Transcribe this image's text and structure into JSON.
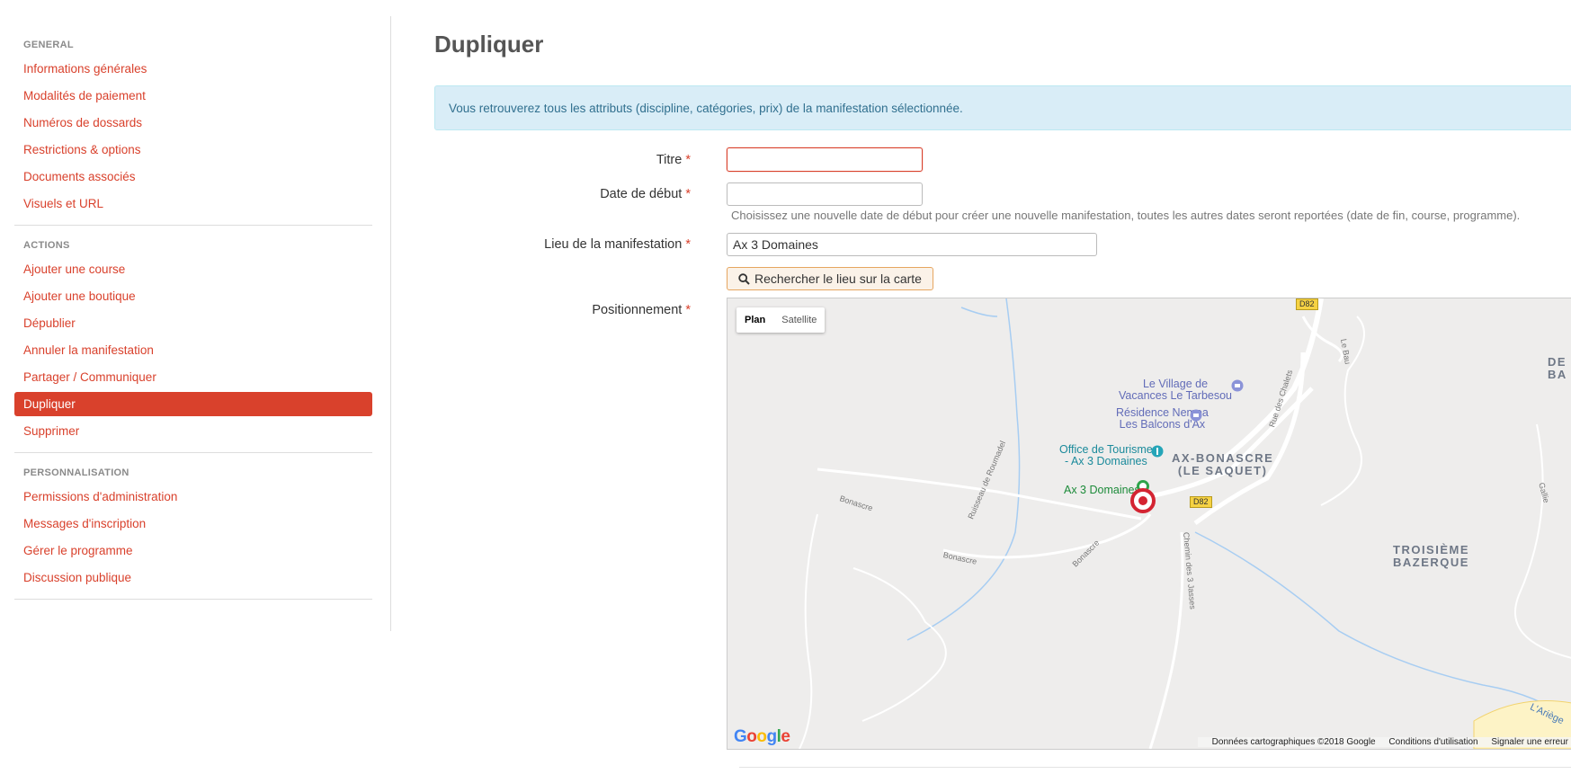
{
  "sidebar": {
    "general_title": "GENERAL",
    "general_items": [
      "Informations générales",
      "Modalités de paiement",
      "Numéros de dossards",
      "Restrictions & options",
      "Documents associés",
      "Visuels et URL"
    ],
    "actions_title": "ACTIONS",
    "actions_items": [
      "Ajouter une course",
      "Ajouter une boutique",
      "Dépublier",
      "Annuler la manifestation",
      "Partager / Communiquer",
      "Dupliquer",
      "Supprimer"
    ],
    "perso_title": "PERSONNALISATION",
    "perso_items": [
      "Permissions d'administration",
      "Messages d'inscription",
      "Gérer le programme",
      "Discussion publique"
    ],
    "active_item": "Dupliquer"
  },
  "page": {
    "title": "Dupliquer",
    "info": "Vous retrouverez tous les attributs (discipline, catégories, prix) de la manifestation sélectionnée."
  },
  "form": {
    "required_mark": "*",
    "titre_label": "Titre",
    "titre_value": "",
    "date_label": "Date de début",
    "date_value": "",
    "date_help": "Choisissez une nouvelle date de début pour créer une nouvelle manifestation, toutes les autres dates seront reportées (date de fin, course, programme).",
    "lieu_label": "Lieu de la manifestation",
    "lieu_value": "Ax 3 Domaines",
    "search_button": "Rechercher le lieu sur la carte",
    "position_label": "Positionnement"
  },
  "map": {
    "plan": "Plan",
    "satellite": "Satellite",
    "poi_village": "Le Village de\nVacances Le Tarbesou",
    "poi_residence": "Résidence Nemea\nLes Balcons d'Ax",
    "poi_office": "Office de Tourisme\n- Ax 3 Domaines",
    "poi_ax": "Ax 3 Domaines",
    "area_bonascre": "AX-BONASCRE\n(LE SAQUET)",
    "area_troisieme": "TROISIÈME\nBAZERQUE",
    "area_de": "DE\nBA",
    "road_d82": "D82",
    "street_ruisseau": "Ruisseau de Roumadel",
    "street_chalets": "Rue des Chalets",
    "street_bonascre": "Bonascre",
    "street_jasses": "Chemin des 3 Jasses",
    "street_ariege": "L'Ariège",
    "street_lebau": "Le Bau",
    "street_gallie": "Gallie",
    "google": "Google",
    "footer_data": "Données cartographiques ©2018 Google",
    "footer_terms": "Conditions d'utilisation",
    "footer_report": "Signaler une erreur",
    "colors": {
      "water": "#a7cdf2",
      "road": "#ffffff",
      "bg": "#eeedec",
      "marker": "#d42432"
    }
  }
}
